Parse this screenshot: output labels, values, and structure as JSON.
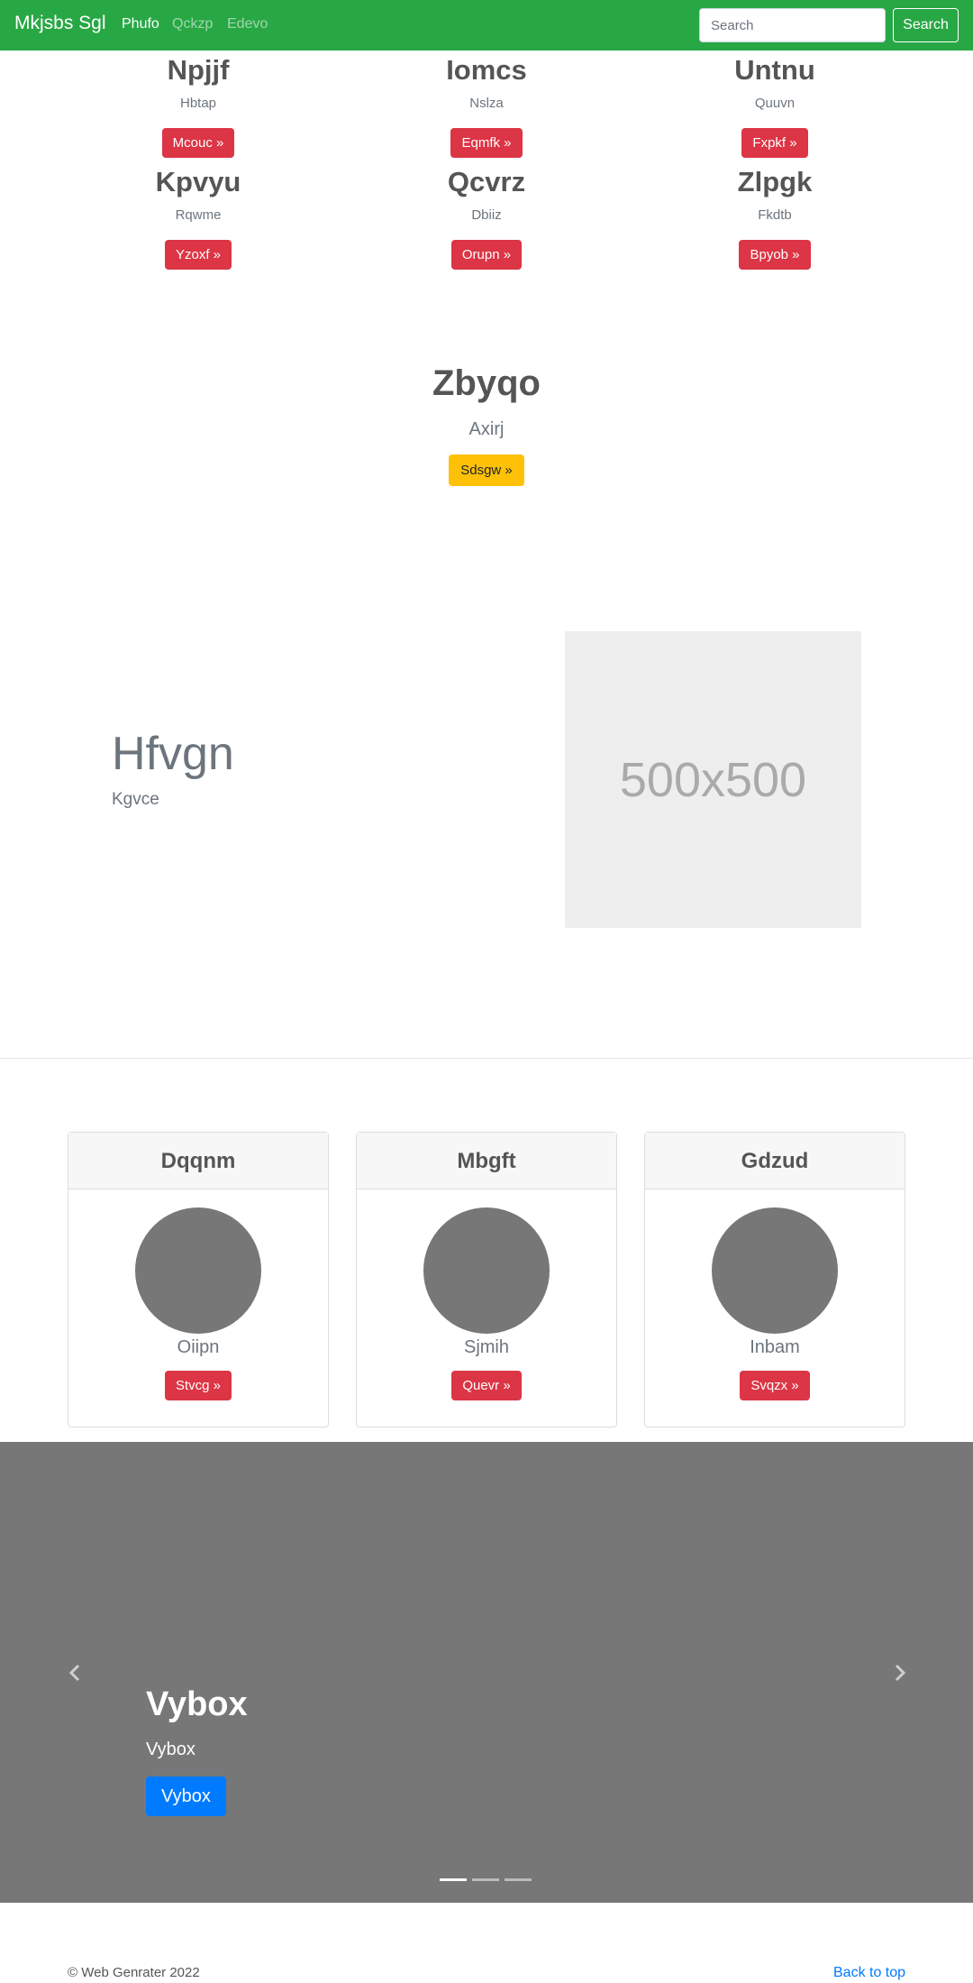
{
  "navbar": {
    "brand": "Mkjsbs Sgl",
    "links": [
      "Phufo",
      "Qckzp",
      "Edevo"
    ],
    "search_placeholder": "Search",
    "search_button": "Search"
  },
  "features": [
    {
      "title": "Npjjf",
      "subtitle": "Hbtap",
      "button": "Mcouc »"
    },
    {
      "title": "Iomcs",
      "subtitle": "Nslza",
      "button": "Eqmfk »"
    },
    {
      "title": "Untnu",
      "subtitle": "Quuvn",
      "button": "Fxpkf »"
    },
    {
      "title": "Kpvyu",
      "subtitle": "Rqwme",
      "button": "Yzoxf »"
    },
    {
      "title": "Qcvrz",
      "subtitle": "Dbiiz",
      "button": "Orupn »"
    },
    {
      "title": "Zlpgk",
      "subtitle": "Fkdtb",
      "button": "Bpyob »"
    }
  ],
  "hero_center": {
    "title": "Zbyqo",
    "subtitle": "Axirj",
    "button": "Sdsgw »"
  },
  "split_hero": {
    "title": "Hfvgn",
    "subtitle": "Kgvce",
    "image_label": "500x500"
  },
  "cards": [
    {
      "header": "Dqqnm",
      "text": "Oiipn",
      "button": "Stvcg »"
    },
    {
      "header": "Mbgft",
      "text": "Sjmih",
      "button": "Quevr »"
    },
    {
      "header": "Gdzud",
      "text": "Inbam",
      "button": "Svqzx »"
    }
  ],
  "carousel": {
    "title": "Vybox",
    "subtitle": "Vybox",
    "button": "Vybox",
    "slide_count": 3,
    "active_slide": 1
  },
  "footer": {
    "copyright": "© Web Genrater 2022",
    "back_to_top": "Back to top"
  },
  "colors": {
    "navbar": "#28a745",
    "danger": "#dc3545",
    "warning": "#ffc107",
    "primary": "#007bff",
    "carousel_bg": "#777777"
  }
}
